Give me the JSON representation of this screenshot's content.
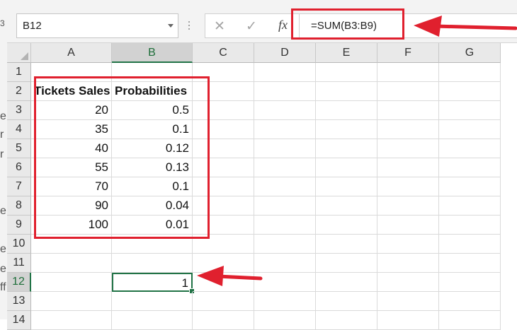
{
  "formula_bar": {
    "name_box": "B12",
    "cancel_glyph": "✕",
    "enter_glyph": "✓",
    "function_glyph": "fx",
    "formula": "=SUM(B3:B9)"
  },
  "columns": [
    "A",
    "B",
    "C",
    "D",
    "E",
    "F",
    "G"
  ],
  "rows": [
    "1",
    "2",
    "3",
    "4",
    "5",
    "6",
    "7",
    "8",
    "9",
    "10",
    "11",
    "12",
    "13",
    "14"
  ],
  "cells": {
    "A2": "Tickets Sales",
    "B2": "Probabilities",
    "A3": "20",
    "B3": "0.5",
    "A4": "35",
    "B4": "0.1",
    "A5": "40",
    "B5": "0.12",
    "A6": "55",
    "B6": "0.13",
    "A7": "70",
    "B7": "0.1",
    "A8": "90",
    "B8": "0.04",
    "A9": "100",
    "B9": "0.01",
    "B12": "1"
  },
  "selection": {
    "active_cell": "B12",
    "active_column": "B",
    "active_row": "12"
  },
  "annotation_color": "#e0202e",
  "left_edge_glyphs": [
    "3",
    "e",
    "r",
    "r",
    "e",
    "e",
    "e",
    "ff"
  ]
}
